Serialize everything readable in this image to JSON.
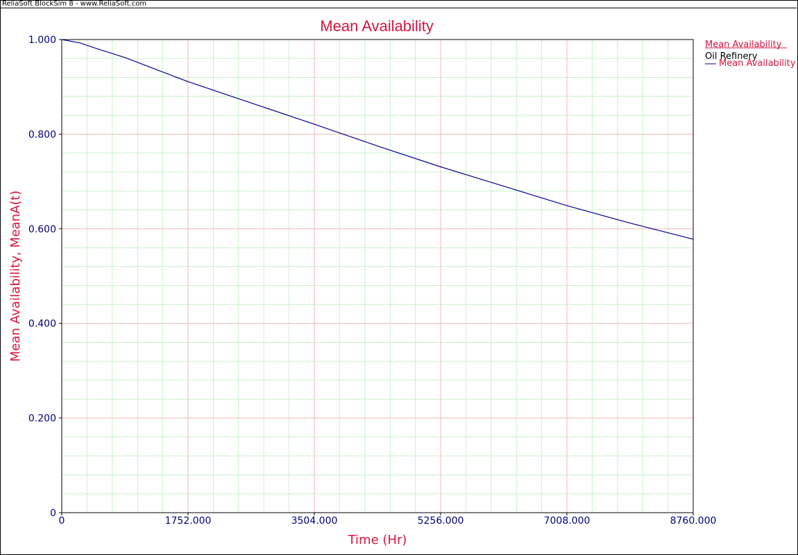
{
  "window": {
    "title": "ReliaSoft BlockSim 8 - www.ReliaSoft.com"
  },
  "colors": {
    "title_text": "#dc143c",
    "axis_text": "#00007f",
    "series_line": "#00008b",
    "major_grid": "#f2b7b7",
    "minor_grid": "#c8f0c8"
  },
  "chart_data": {
    "type": "line",
    "title": "Mean Availability",
    "xlabel": "Time (Hr)",
    "ylabel": "Mean Availability, MeanA(t)",
    "xlim": [
      0,
      8760
    ],
    "ylim": [
      0,
      1
    ],
    "x_ticks": [
      0,
      1752,
      3504,
      5256,
      7008,
      8760
    ],
    "x_tick_labels": [
      "0",
      "1752.000",
      "3504.000",
      "5256.000",
      "7008.000",
      "8760.000"
    ],
    "y_ticks": [
      0,
      0.2,
      0.4,
      0.6,
      0.8,
      1.0
    ],
    "y_tick_labels": [
      "0",
      "0.200",
      "0.400",
      "0.600",
      "0.800",
      "1.000"
    ],
    "grid": true,
    "legend": {
      "placement": "right",
      "heading": "Mean Availability",
      "group": "Oil Refinery",
      "entries": [
        "Mean Availability"
      ]
    },
    "series": [
      {
        "name": "Mean Availability",
        "x": [
          0,
          250,
          500,
          876,
          1752,
          2628,
          3504,
          4380,
          5256,
          6132,
          7008,
          7884,
          8760
        ],
        "y": [
          1.0,
          0.993,
          0.98,
          0.962,
          0.911,
          0.866,
          0.821,
          0.775,
          0.731,
          0.69,
          0.649,
          0.612,
          0.578
        ]
      }
    ]
  }
}
